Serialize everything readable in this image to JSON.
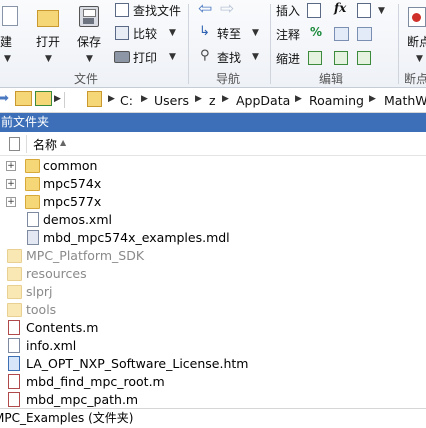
{
  "ribbon": {
    "new_label": "新建",
    "open_label": "打开",
    "save_label": "保存",
    "find_files": "查找文件",
    "compare": "比较",
    "print": "打印",
    "go_to": "转至",
    "find": "查找",
    "insert": "插入",
    "comment": "注释",
    "indent": "缩进",
    "fx": "fx",
    "percent": "%",
    "break_label": "断点",
    "groups": {
      "file": "文件",
      "navigate": "导航",
      "edit": "编辑",
      "breakpoints": "断点"
    }
  },
  "address": {
    "crumbs": [
      "C:",
      "Users",
      "z",
      "AppData",
      "Roaming",
      "MathW"
    ]
  },
  "panel": {
    "title": "当前文件夹"
  },
  "columns": {
    "name": "名称"
  },
  "files": [
    {
      "name": "common",
      "type": "folder",
      "expandable": true,
      "dim": false
    },
    {
      "name": "mpc574x",
      "type": "folder",
      "expandable": true,
      "dim": false
    },
    {
      "name": "mpc577x",
      "type": "folder",
      "expandable": true,
      "dim": false
    },
    {
      "name": "demos.xml",
      "type": "xml",
      "expandable": false,
      "dim": false
    },
    {
      "name": "mbd_mpc574x_examples.mdl",
      "type": "mdl",
      "expandable": false,
      "dim": false
    },
    {
      "name": "MPC_Platform_SDK",
      "type": "folder",
      "expandable": false,
      "dim": true
    },
    {
      "name": "resources",
      "type": "folder",
      "expandable": false,
      "dim": true
    },
    {
      "name": "slprj",
      "type": "folder",
      "expandable": false,
      "dim": true
    },
    {
      "name": "tools",
      "type": "folder",
      "expandable": false,
      "dim": true
    },
    {
      "name": "Contents.m",
      "type": "m",
      "expandable": false,
      "dim": false
    },
    {
      "name": "info.xml",
      "type": "xml",
      "expandable": false,
      "dim": false
    },
    {
      "name": "LA_OPT_NXP_Software_License.htm",
      "type": "htm",
      "expandable": false,
      "dim": false
    },
    {
      "name": "mbd_find_mpc_root.m",
      "type": "m",
      "expandable": false,
      "dim": false
    },
    {
      "name": "mbd_mpc_path.m",
      "type": "m",
      "expandable": false,
      "dim": false
    }
  ],
  "status": {
    "text": "MPC_Examples  (文件夹)"
  }
}
